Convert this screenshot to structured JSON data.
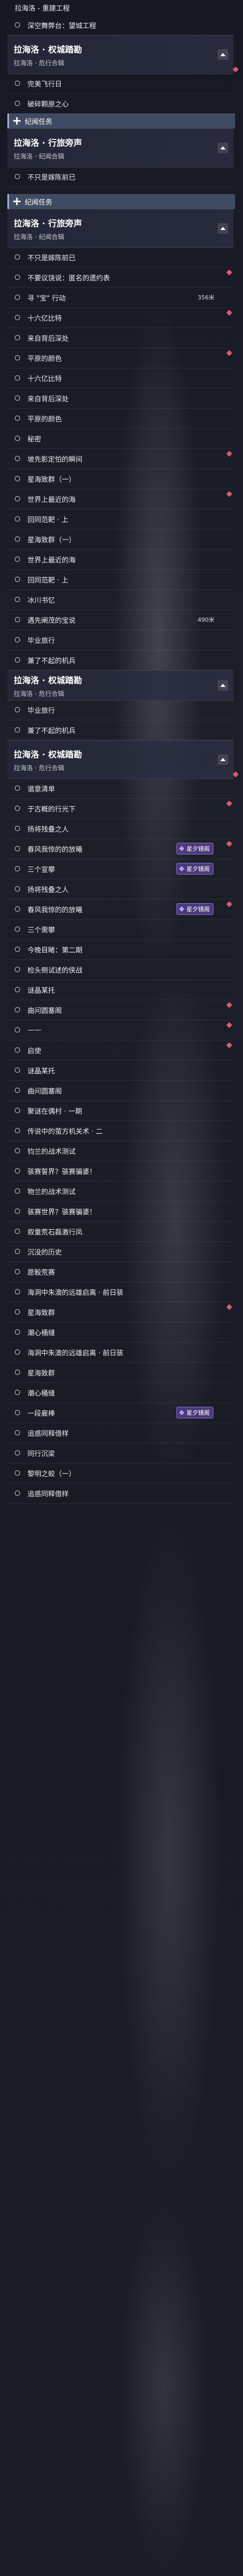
{
  "top_bar": {
    "label": "拉海洛 - 重建工程"
  },
  "blocks": [
    {
      "k": "item",
      "t": "深空舞弊台：望城工程"
    },
    {
      "k": "chapter",
      "t": "拉海洛 · 权城踏勘",
      "s": "拉海洛 · 危行合辑",
      "pin": true
    },
    {
      "k": "item",
      "t": "完美飞行日"
    },
    {
      "k": "item",
      "t": "破碎颗原之心"
    },
    {
      "k": "section",
      "t": "纪闻任务"
    },
    {
      "k": "chapter",
      "t": "拉海洛 · 行旅旁声",
      "s": "拉海洛 · 纪闻合辑"
    },
    {
      "k": "item",
      "t": "不只是嫁陈前已"
    },
    {
      "k": "gap"
    },
    {
      "k": "section",
      "t": "纪闻任务"
    },
    {
      "k": "chapter",
      "t": "拉海洛 · 行旅旁声",
      "s": "拉海洛 · 纪闻合辑"
    },
    {
      "k": "item",
      "t": "不只是嫁陈前已"
    },
    {
      "k": "item",
      "t": "不要议饶说：匿名的遗约表",
      "pin": true
    },
    {
      "k": "item",
      "t": "寻 \"宝\" 行动",
      "d": "356米"
    },
    {
      "k": "item",
      "t": "十六亿比特",
      "pin": true
    },
    {
      "k": "item",
      "t": "来自背后深处"
    },
    {
      "k": "item",
      "t": "平原的颜色",
      "pin": true
    },
    {
      "k": "item",
      "t": "十六亿比特"
    },
    {
      "k": "item",
      "t": "来自背后深处"
    },
    {
      "k": "item",
      "t": "平原的颜色"
    },
    {
      "k": "item",
      "t": "秘密"
    },
    {
      "k": "item",
      "t": "坡先影定怕的瞬间",
      "pin": true
    },
    {
      "k": "item",
      "t": "星海致群（一）"
    },
    {
      "k": "item",
      "t": "世界上最近的海",
      "pin": true
    },
    {
      "k": "item",
      "t": "回同范靶 · 上"
    },
    {
      "k": "item",
      "t": "星海致群（一）"
    },
    {
      "k": "item",
      "t": "世界上最近的海"
    },
    {
      "k": "item",
      "t": "回同范靶 · 上"
    },
    {
      "k": "item",
      "t": "冰川书忆"
    },
    {
      "k": "item",
      "t": "遇先阐茂的宝说",
      "d": "490米"
    },
    {
      "k": "item",
      "t": "毕业旅行"
    },
    {
      "k": "item",
      "t": "兼了不起的机兵"
    },
    {
      "k": "chapter",
      "small": true,
      "t": "拉海洛 · 权城踏勘",
      "s": "拉海洛 · 危行合辑"
    },
    {
      "k": "item",
      "t": "毕业旅行"
    },
    {
      "k": "item",
      "t": "兼了不起的机兵"
    },
    {
      "k": "chapter",
      "t": "拉海洛 · 权城踏勘",
      "s": "拉海洛 · 危行合辑",
      "pin": true
    },
    {
      "k": "item",
      "t": "谐意清单"
    },
    {
      "k": "item",
      "t": "于古概的行光下",
      "pin": true
    },
    {
      "k": "item",
      "t": "扬将残叠之人"
    },
    {
      "k": "item",
      "t": "春风我惊的的放曦",
      "tag": "星夕镜阁",
      "pin": true
    },
    {
      "k": "item",
      "t": "三个宣攀",
      "tag": "星夕镜阁"
    },
    {
      "k": "item",
      "t": "扬将残叠之人"
    },
    {
      "k": "item",
      "t": "春风我惊的的放曦",
      "tag": "星夕镜阁",
      "pin": true
    },
    {
      "k": "item",
      "t": "三个需攀"
    },
    {
      "k": "item",
      "t": "今晚目睹：第二期"
    },
    {
      "k": "item",
      "t": "检头侧试述的侠战"
    },
    {
      "k": "item",
      "t": "谜晶某托"
    },
    {
      "k": "item",
      "t": "曲问圆塞阁",
      "pin": true
    },
    {
      "k": "item",
      "t": "——",
      "pin": true
    },
    {
      "k": "item",
      "t": "启使",
      "pin": true
    },
    {
      "k": "item",
      "t": "谜晶某托"
    },
    {
      "k": "item",
      "t": "曲问圆塞阁"
    },
    {
      "k": "item",
      "t": "聚谜在偶村 · 一期"
    },
    {
      "k": "item",
      "t": "传说中的萤方机关术 · 二"
    },
    {
      "k": "item",
      "t": "钧兰的战术测试"
    },
    {
      "k": "item",
      "t": "骇赛誓界？骇赛骗婆！"
    },
    {
      "k": "item",
      "t": "物兰的战术测试"
    },
    {
      "k": "item",
      "t": "骇赛世界？骇赛骗婆！"
    },
    {
      "k": "item",
      "t": "叙童荒石磊激行凤"
    },
    {
      "k": "item",
      "t": "沉没的历史"
    },
    {
      "k": "item",
      "t": "愿骰荒赛"
    },
    {
      "k": "item",
      "t": "海洞中朱澳的远雄启离 · 前日骇"
    },
    {
      "k": "item",
      "t": "星海致群",
      "pin": true
    },
    {
      "k": "item",
      "t": "潮心桶缝"
    },
    {
      "k": "item",
      "t": "海洞中朱澳的远雄启离 · 前日骇"
    },
    {
      "k": "item",
      "t": "星海致群"
    },
    {
      "k": "item",
      "t": "潮心桶缝"
    },
    {
      "k": "item",
      "t": "一段雇棒",
      "tag": "星夕镜阁"
    },
    {
      "k": "item",
      "t": "追惑同释借样"
    },
    {
      "k": "item",
      "t": "同行沉梁"
    },
    {
      "k": "item",
      "t": "黎明之蛟（一）"
    },
    {
      "k": "item",
      "t": "追惑同释借样"
    }
  ]
}
